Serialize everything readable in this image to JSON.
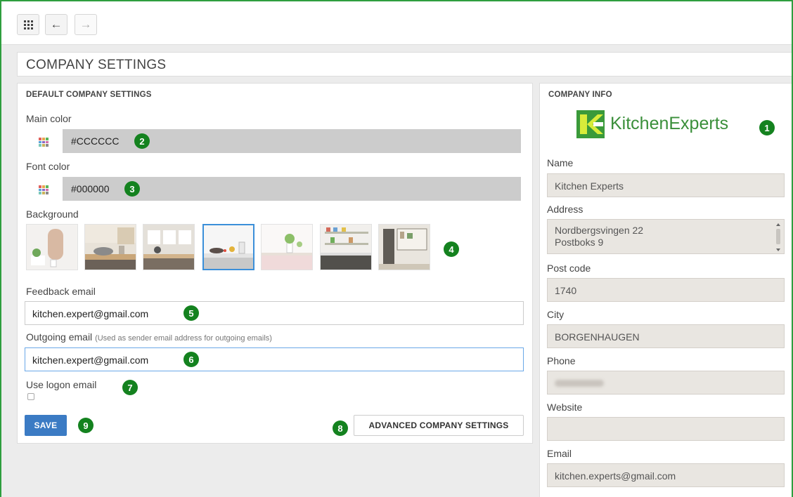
{
  "toolbar": {
    "apps_icon": "grid-icon",
    "back_glyph": "←",
    "forward_glyph": "→"
  },
  "page": {
    "title": "COMPANY SETTINGS"
  },
  "default_settings": {
    "title": "DEFAULT COMPANY SETTINGS",
    "main_color_label": "Main color",
    "main_color_value": "#CCCCCC",
    "font_color_label": "Font color",
    "font_color_value": "#000000",
    "background_label": "Background",
    "backgrounds_selected_index": 3,
    "feedback_email_label": "Feedback email",
    "feedback_email_value": "kitchen.expert@gmail.com",
    "outgoing_email_label": "Outgoing email",
    "outgoing_email_hint": "(Used as sender email address for outgoing emails)",
    "outgoing_email_value": "kitchen.expert@gmail.com",
    "use_logon_label": "Use logon email",
    "use_logon_checked": false,
    "save_label": "SAVE",
    "advanced_label": "ADVANCED COMPANY SETTINGS"
  },
  "company_info": {
    "title": "COMPANY INFO",
    "logo_text": "KitchenExperts",
    "name_label": "Name",
    "name_value": "Kitchen Experts",
    "address_label": "Address",
    "address_line1": "Nordbergsvingen 22",
    "address_line2": "Postboks 9",
    "postcode_label": "Post code",
    "postcode_value": "1740",
    "city_label": "City",
    "city_value": "BORGENHAUGEN",
    "phone_label": "Phone",
    "phone_value": "",
    "website_label": "Website",
    "website_value": "",
    "email_label": "Email",
    "email_value": "kitchen.experts@gmail.com"
  },
  "badges": [
    "1",
    "2",
    "3",
    "4",
    "5",
    "6",
    "7",
    "8",
    "9"
  ],
  "colors": {
    "accent": "#3b7bc4",
    "badge": "#14821f",
    "frame": "#2e9e3e",
    "logo_green": "#3a9a3a"
  }
}
